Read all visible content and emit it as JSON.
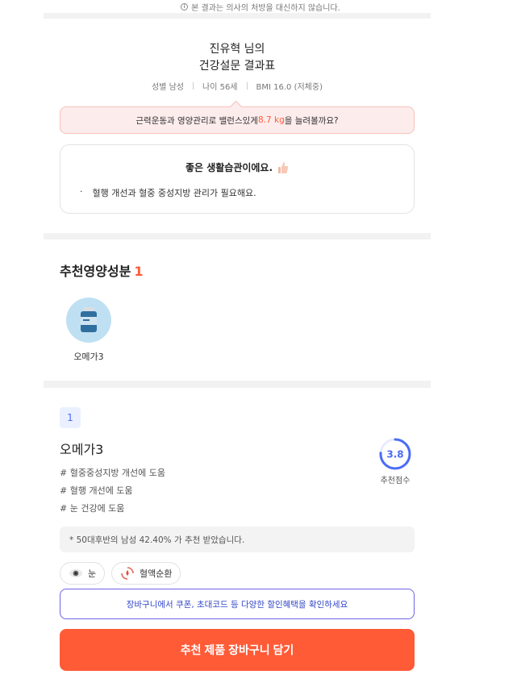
{
  "notice": {
    "text": "본 결과는 의사의 처방을 대신하지 않습니다."
  },
  "result": {
    "name_line": "진유혁 님의",
    "title_line": "건강설문 결과표",
    "meta": {
      "gender": "성별 남성",
      "age": "나이 56세",
      "bmi": "BMI 16.0 (저체중)"
    },
    "alert": {
      "prefix": "근력운동과 영양관리로 밸런스있게 ",
      "highlight": "8.7 kg",
      "suffix": "을 늘려볼까요?"
    },
    "habit": {
      "title": "좋은 생활습관이에요.",
      "bullet": "·",
      "item": "혈행 개선과 혈중 중성지방 관리가 필요해요."
    }
  },
  "recommend": {
    "title": "추천영양성분",
    "count": "1",
    "items": [
      {
        "label": "오메가3",
        "icon": "supplement-bottle-icon"
      }
    ]
  },
  "product": {
    "rank": "1",
    "name": "오메가3",
    "tags": [
      "# 혈중중성지방 개선에 도움",
      "# 혈행 개선에 도움",
      "# 눈 건강에 도움"
    ],
    "score": "3.8",
    "score_fraction": 0.76,
    "score_label": "추천점수",
    "stat": "* 50대후반의 남성 42.40% 가 추천 받았습니다.",
    "chips": [
      {
        "label": "눈",
        "icon": "eye-icon"
      },
      {
        "label": "혈액순환",
        "icon": "blood-circulation-icon"
      }
    ]
  },
  "bottom": {
    "coupon_text": "장바구니에서 쿠폰, 초대코드 등 다양한 할인혜택을 확인하세요",
    "cta_label": "추천 제품 장바구니 담기"
  },
  "colors": {
    "accent": "#ff5b37",
    "score_ring": "#4a6cf7",
    "alert_bg": "#fdecec"
  }
}
